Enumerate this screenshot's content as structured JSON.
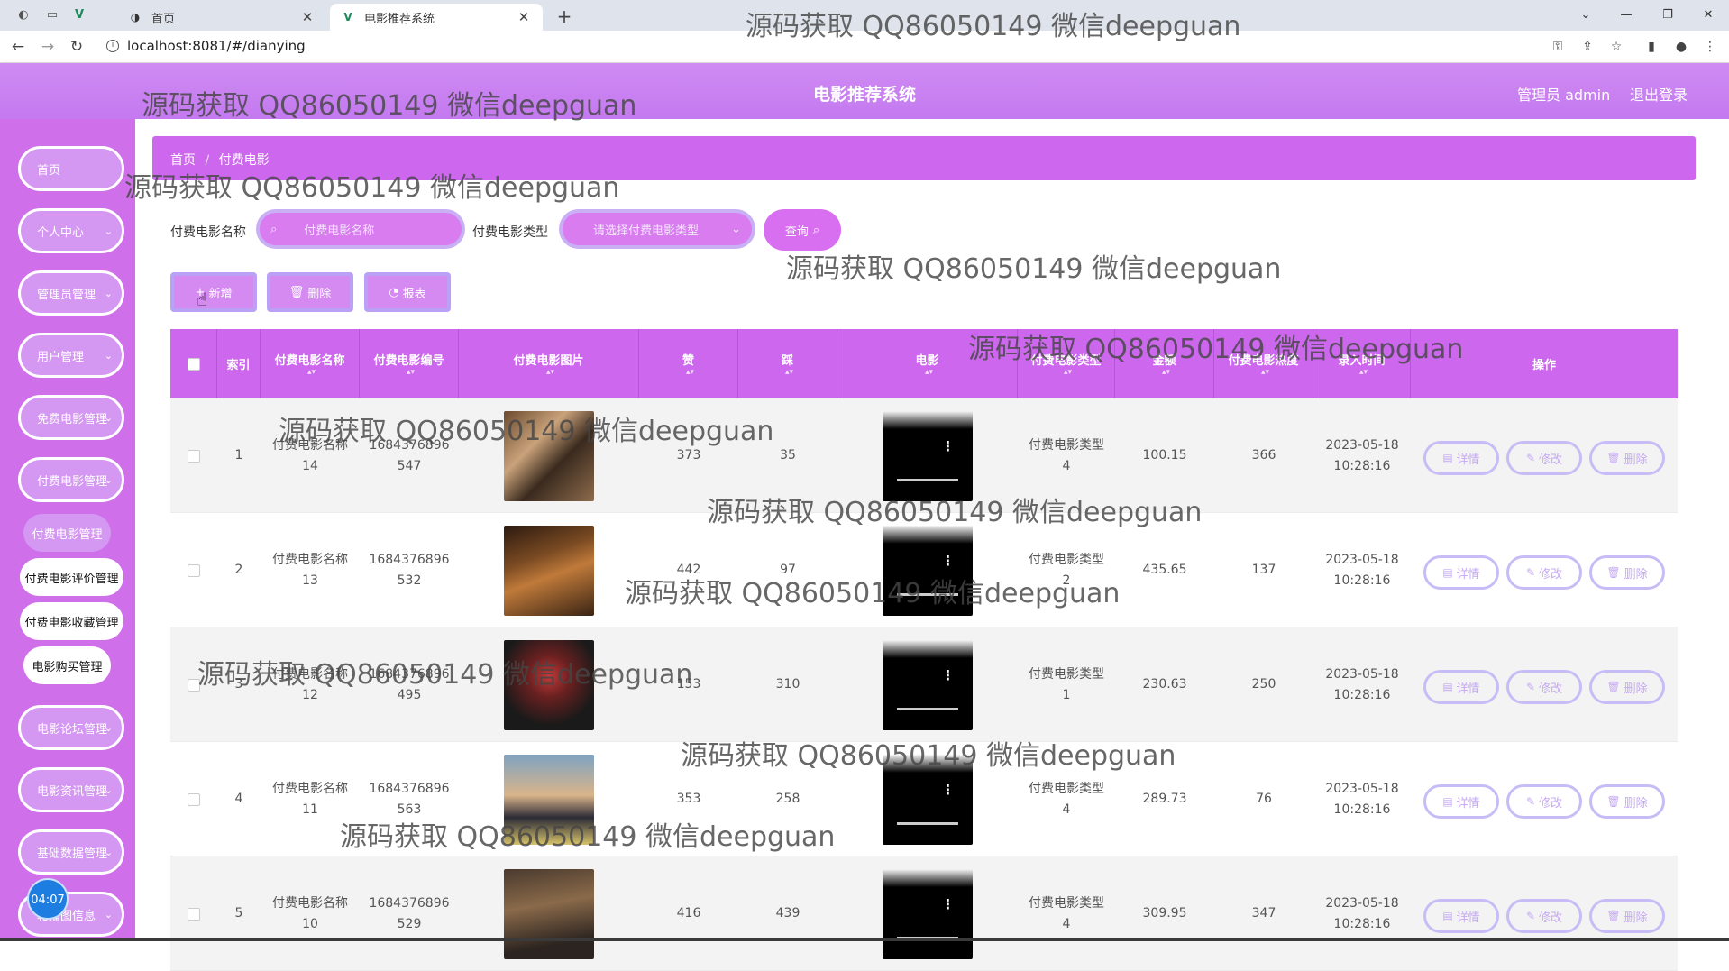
{
  "browser": {
    "tabs": [
      {
        "label": "首页",
        "active": false
      },
      {
        "label": "电影推荐系统",
        "active": true
      }
    ],
    "url": "localhost:8081/#/dianying"
  },
  "header": {
    "title": "电影推荐系统",
    "user": "管理员 admin",
    "logout": "退出登录"
  },
  "sidebar": {
    "menus": [
      {
        "label": "首页",
        "caret": ""
      },
      {
        "label": "个人中心",
        "caret": "⌄"
      },
      {
        "label": "管理员管理",
        "caret": "⌄"
      },
      {
        "label": "用户管理",
        "caret": "⌄"
      },
      {
        "label": "免费电影管理",
        "caret": "⌄"
      },
      {
        "label": "付费电影管理",
        "caret": "⌄"
      }
    ],
    "submenus": [
      {
        "label": "付费电影管理"
      },
      {
        "label": "付费电影评价管理"
      },
      {
        "label": "付费电影收藏管理"
      },
      {
        "label": "电影购买管理"
      }
    ],
    "menus_lower": [
      {
        "label": "电影论坛管理",
        "caret": "⌄"
      },
      {
        "label": "电影资讯管理",
        "caret": "⌄"
      },
      {
        "label": "基础数据管理",
        "caret": "⌄"
      },
      {
        "label": "轮播图信息",
        "caret": "⌄"
      }
    ],
    "timer": "04:07"
  },
  "breadcrumb": {
    "home": "首页",
    "sep": "/",
    "current": "付费电影"
  },
  "search": {
    "name_label": "付费电影名称",
    "name_placeholder": "付费电影名称",
    "type_label": "付费电影类型",
    "type_placeholder": "请选择付费电影类型",
    "query_button": "查询"
  },
  "actions": {
    "add": "新增",
    "delete": "删除",
    "report": "报表"
  },
  "table": {
    "columns": [
      {
        "key": "checkbox",
        "label": "",
        "sortable": false
      },
      {
        "key": "index",
        "label": "索引",
        "sortable": false
      },
      {
        "key": "name",
        "label": "付费电影名称",
        "sortable": true
      },
      {
        "key": "code",
        "label": "付费电影编号",
        "sortable": true
      },
      {
        "key": "photo",
        "label": "付费电影图片",
        "sortable": true
      },
      {
        "key": "zan",
        "label": "赞",
        "sortable": true
      },
      {
        "key": "cai",
        "label": "踩",
        "sortable": true
      },
      {
        "key": "video",
        "label": "电影",
        "sortable": true
      },
      {
        "key": "type",
        "label": "付费电影类型",
        "sortable": true
      },
      {
        "key": "price",
        "label": "金额",
        "sortable": true
      },
      {
        "key": "clicks",
        "label": "付费电影热度",
        "sortable": true
      },
      {
        "key": "time",
        "label": "录入时间",
        "sortable": true
      },
      {
        "key": "ops",
        "label": "操作",
        "sortable": false
      }
    ],
    "rows": [
      {
        "index": "1",
        "name": "付费电影名称14",
        "code": "1684376896547",
        "zan": "373",
        "cai": "35",
        "type": "付费电影类型4",
        "price": "100.15",
        "clicks": "366",
        "date": "2023-05-18",
        "time": "10:28:16",
        "poster": "poster-couple"
      },
      {
        "index": "2",
        "name": "付费电影名称13",
        "code": "1684376896532",
        "zan": "442",
        "cai": "97",
        "type": "付费电影类型2",
        "price": "435.65",
        "clicks": "137",
        "date": "2023-05-18",
        "time": "10:28:16",
        "poster": "poster-dinner"
      },
      {
        "index": "3",
        "name": "付费电影名称12",
        "code": "1684376896495",
        "zan": "153",
        "cai": "310",
        "type": "付费电影类型1",
        "price": "230.63",
        "clicks": "250",
        "date": "2023-05-18",
        "time": "10:28:16",
        "poster": "poster-joker"
      },
      {
        "index": "4",
        "name": "付费电影名称11",
        "code": "1684376896563",
        "zan": "353",
        "cai": "258",
        "type": "付费电影类型4",
        "price": "289.73",
        "clicks": "76",
        "date": "2023-05-18",
        "time": "10:28:16",
        "poster": "poster-titanic"
      },
      {
        "index": "5",
        "name": "付费电影名称10",
        "code": "1684376896529",
        "zan": "416",
        "cai": "439",
        "type": "付费电影类型4",
        "price": "309.95",
        "clicks": "347",
        "date": "2023-05-18",
        "time": "10:28:16",
        "poster": "poster-group"
      }
    ],
    "row_buttons": {
      "detail": "详情",
      "edit": "修改",
      "delete": "删除"
    }
  },
  "watermark": "源码获取 QQ86050149 微信deepguan",
  "colors": {
    "primary": "#cd68ee",
    "header": "#c87ef2",
    "sidebar": "#cf6fea",
    "button_border": "#c8bcf6"
  }
}
